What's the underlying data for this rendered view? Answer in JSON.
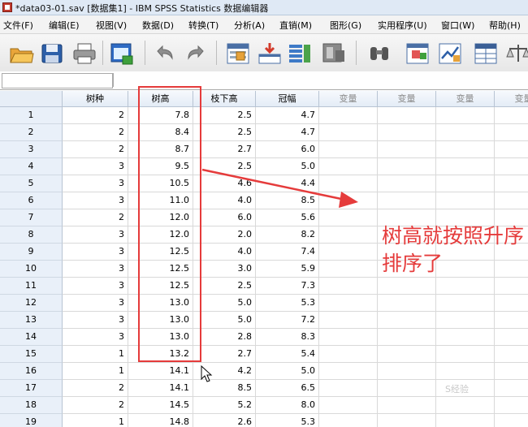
{
  "window": {
    "title": "*data03-01.sav [数据集1] - IBM SPSS Statistics 数据编辑器"
  },
  "menu": [
    {
      "label": "文件(F)",
      "name": "menu-file"
    },
    {
      "label": "编辑(E)",
      "name": "menu-edit"
    },
    {
      "label": "视图(V)",
      "name": "menu-view"
    },
    {
      "label": "数据(D)",
      "name": "menu-data"
    },
    {
      "label": "转换(T)",
      "name": "menu-transform"
    },
    {
      "label": "分析(A)",
      "name": "menu-analyze"
    },
    {
      "label": "直销(M)",
      "name": "menu-direct-marketing"
    },
    {
      "label": "图形(G)",
      "name": "menu-graphs"
    },
    {
      "label": "实用程序(U)",
      "name": "menu-utilities"
    },
    {
      "label": "窗口(W)",
      "name": "menu-window"
    },
    {
      "label": "帮助(H)",
      "name": "menu-help"
    }
  ],
  "toolbar": [
    {
      "icon": "open-folder-icon"
    },
    {
      "icon": "save-icon"
    },
    {
      "icon": "print-icon"
    },
    {
      "icon": "recall-dialog-icon"
    },
    {
      "icon": "undo-icon"
    },
    {
      "icon": "redo-icon"
    },
    {
      "icon": "go-to-case-icon"
    },
    {
      "icon": "go-to-variable-icon"
    },
    {
      "icon": "variables-icon"
    },
    {
      "icon": "run-descriptives-icon"
    },
    {
      "icon": "find-icon"
    },
    {
      "icon": "insert-cases-icon"
    },
    {
      "icon": "insert-variable-icon"
    },
    {
      "icon": "split-file-icon"
    },
    {
      "icon": "weight-cases-icon"
    }
  ],
  "grid": {
    "columns": [
      "树种",
      "树高",
      "枝下高",
      "冠幅",
      "变量",
      "变量",
      "变量",
      "变量"
    ],
    "rows": [
      {
        "n": "1",
        "cells": [
          "2",
          "7.8",
          "2.5",
          "4.7"
        ]
      },
      {
        "n": "2",
        "cells": [
          "2",
          "8.4",
          "2.5",
          "4.7"
        ]
      },
      {
        "n": "3",
        "cells": [
          "2",
          "8.7",
          "2.7",
          "6.0"
        ]
      },
      {
        "n": "4",
        "cells": [
          "3",
          "9.5",
          "2.5",
          "5.0"
        ]
      },
      {
        "n": "5",
        "cells": [
          "3",
          "10.5",
          "4.6",
          "4.4"
        ]
      },
      {
        "n": "6",
        "cells": [
          "3",
          "11.0",
          "4.0",
          "8.5"
        ]
      },
      {
        "n": "7",
        "cells": [
          "2",
          "12.0",
          "6.0",
          "5.6"
        ]
      },
      {
        "n": "8",
        "cells": [
          "3",
          "12.0",
          "2.0",
          "8.2"
        ]
      },
      {
        "n": "9",
        "cells": [
          "3",
          "12.5",
          "4.0",
          "7.4"
        ]
      },
      {
        "n": "10",
        "cells": [
          "3",
          "12.5",
          "3.0",
          "5.9"
        ]
      },
      {
        "n": "11",
        "cells": [
          "3",
          "12.5",
          "2.5",
          "7.3"
        ]
      },
      {
        "n": "12",
        "cells": [
          "3",
          "13.0",
          "5.0",
          "5.3"
        ]
      },
      {
        "n": "13",
        "cells": [
          "3",
          "13.0",
          "5.0",
          "7.2"
        ]
      },
      {
        "n": "14",
        "cells": [
          "3",
          "13.0",
          "2.8",
          "8.3"
        ]
      },
      {
        "n": "15",
        "cells": [
          "1",
          "13.2",
          "2.7",
          "5.4"
        ]
      },
      {
        "n": "16",
        "cells": [
          "1",
          "14.1",
          "4.2",
          "5.0"
        ]
      },
      {
        "n": "17",
        "cells": [
          "2",
          "14.1",
          "8.5",
          "6.5"
        ]
      },
      {
        "n": "18",
        "cells": [
          "2",
          "14.5",
          "5.2",
          "8.0"
        ]
      },
      {
        "n": "19",
        "cells": [
          "1",
          "14.8",
          "2.6",
          "5.3"
        ]
      }
    ]
  },
  "annotation": {
    "text": "树高就按照升序排序了",
    "color": "#e53b3b"
  },
  "watermark": "S经验"
}
